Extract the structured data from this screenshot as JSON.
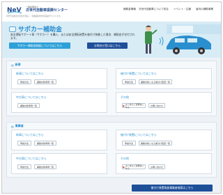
{
  "header": {
    "logo_text": "NeV",
    "org_sub": "一般社団法人",
    "org_name": "次世代自動車振興センター",
    "description": "次世代自動車の普及を目指し、各種補助金交付事業を行っています。",
    "nav": [
      "補助金情報",
      "次世代自動車について知る",
      "イベント・広報",
      "者向の補助事業"
    ]
  },
  "hero": {
    "title": "サポカー補助金",
    "description": "安全運転サポート車（サポカー）を購入、または安全運転装置を後付け装着した場合、補助金が交付されます。",
    "btn_about": "サポカー補助金制度についてはこちら",
    "btn_budget": "お問合せ窓口はこちら"
  },
  "sections": [
    {
      "label": "新車",
      "cards": [
        {
          "title": "新車についてはこちら",
          "chips": [
            "申請方法",
            "補助対象車両一覧"
          ]
        },
        {
          "title": "後付け装置についてはこちら",
          "chips": [
            "申請方法",
            "補助対象となる後付け装置一覧"
          ]
        },
        {
          "title": "中古車についてはこちら",
          "chips": [
            "補助対象車両一覧"
          ]
        },
        {
          "title": "その他",
          "chips": [
            "よくあるご質問はこちら",
            "お問い合わせ"
          ]
        }
      ]
    },
    {
      "label": "事業者",
      "cards": [
        {
          "title": "新車についてはこちら",
          "chips": [
            "申請方法",
            "補助対象車両一覧"
          ]
        },
        {
          "title": "後付け装置についてはこちら",
          "chips": [
            "申請方法",
            "補助対象となる後付け装置一覧"
          ]
        },
        {
          "title": "中古車についてはこちら",
          "chips": [
            "申請方法",
            "補助対象車両一覧"
          ]
        },
        {
          "title": "その他",
          "chips": [
            "よくあるご質問はこちら",
            "お問い合わせ"
          ]
        }
      ]
    }
  ],
  "footer_button": "後付け装置取扱事業者検索はこちら"
}
